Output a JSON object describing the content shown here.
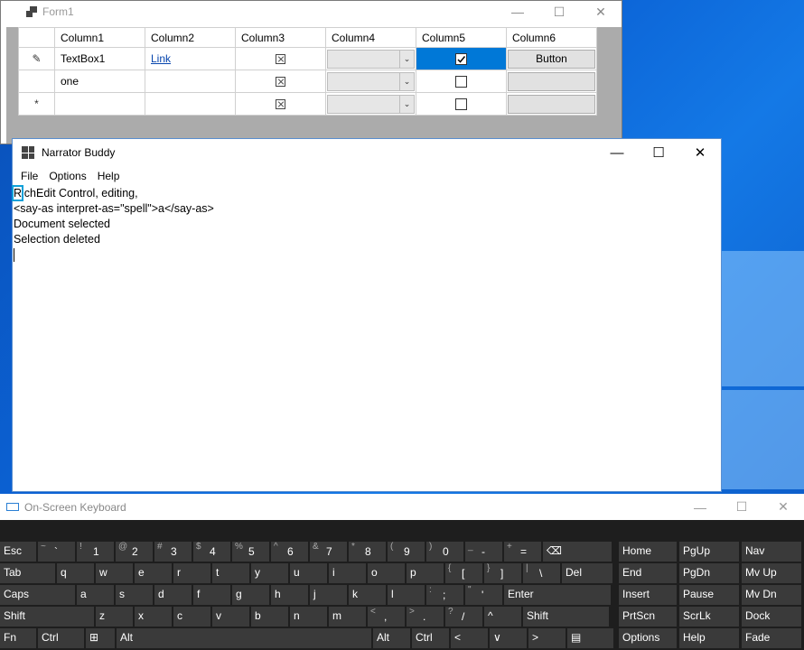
{
  "form1": {
    "title": "Form1",
    "columns": [
      "Column1",
      "Column2",
      "Column3",
      "Column4",
      "Column5",
      "Column6"
    ],
    "rows": [
      {
        "header": "✎",
        "col1": "TextBox1",
        "col2": "Link",
        "col6": "Button"
      },
      {
        "header": "",
        "col1": "one",
        "col2": "",
        "col6": ""
      },
      {
        "header": "*",
        "col1": "",
        "col2": "",
        "col6": ""
      }
    ]
  },
  "narrator": {
    "title": "Narrator Buddy",
    "menu": [
      "File",
      "Options",
      "Help"
    ],
    "lines": [
      "RichEdit Control, editing,",
      "<say-as interpret-as=\"spell\">a</say-as>",
      "Document selected",
      "Selection deleted"
    ],
    "first_char": "R",
    "first_rest": "ichEdit Control, editing,"
  },
  "osk": {
    "title": "On-Screen Keyboard",
    "row1": [
      {
        "sub": "",
        "main": "Esc"
      },
      {
        "sub": "~",
        "main": "`"
      },
      {
        "sub": "!",
        "main": "1"
      },
      {
        "sub": "@",
        "main": "2"
      },
      {
        "sub": "#",
        "main": "3"
      },
      {
        "sub": "$",
        "main": "4"
      },
      {
        "sub": "%",
        "main": "5"
      },
      {
        "sub": "^",
        "main": "6"
      },
      {
        "sub": "&",
        "main": "7"
      },
      {
        "sub": "*",
        "main": "8"
      },
      {
        "sub": "(",
        "main": "9"
      },
      {
        "sub": ")",
        "main": "0"
      },
      {
        "sub": "_",
        "main": "-"
      },
      {
        "sub": "+",
        "main": "="
      },
      {
        "sub": "",
        "main": "⌫"
      }
    ],
    "row2": [
      "Tab",
      "q",
      "w",
      "e",
      "r",
      "t",
      "y",
      "u",
      "i",
      "o",
      "p",
      "[",
      "]",
      "\\",
      "Del"
    ],
    "row2_subs": [
      "",
      "",
      "",
      "",
      "",
      "",
      "",
      "",
      "",
      "",
      "",
      "{",
      "}",
      "|",
      ""
    ],
    "row3": [
      "Caps",
      "a",
      "s",
      "d",
      "f",
      "g",
      "h",
      "j",
      "k",
      "l",
      ";",
      "'",
      "Enter"
    ],
    "row3_subs": [
      "",
      "",
      "",
      "",
      "",
      "",
      "",
      "",
      "",
      "",
      ":",
      "\"",
      ""
    ],
    "row4": [
      "Shift",
      "z",
      "x",
      "c",
      "v",
      "b",
      "n",
      "m",
      ",",
      ".",
      "/",
      "^",
      "Shift"
    ],
    "row4_subs": [
      "",
      "",
      "",
      "",
      "",
      "",
      "",
      "",
      "<",
      ">",
      "?",
      "",
      ""
    ],
    "row5": [
      "Fn",
      "Ctrl",
      "⊞",
      "Alt",
      "Alt",
      "Ctrl",
      "<",
      "∨",
      ">",
      "▤"
    ],
    "nav": [
      [
        "Home",
        "PgUp",
        "Nav"
      ],
      [
        "End",
        "PgDn",
        "Mv Up"
      ],
      [
        "Insert",
        "Pause",
        "Mv Dn"
      ],
      [
        "PrtScn",
        "ScrLk",
        "Dock"
      ],
      [
        "Options",
        "Help",
        "Fade"
      ]
    ]
  }
}
